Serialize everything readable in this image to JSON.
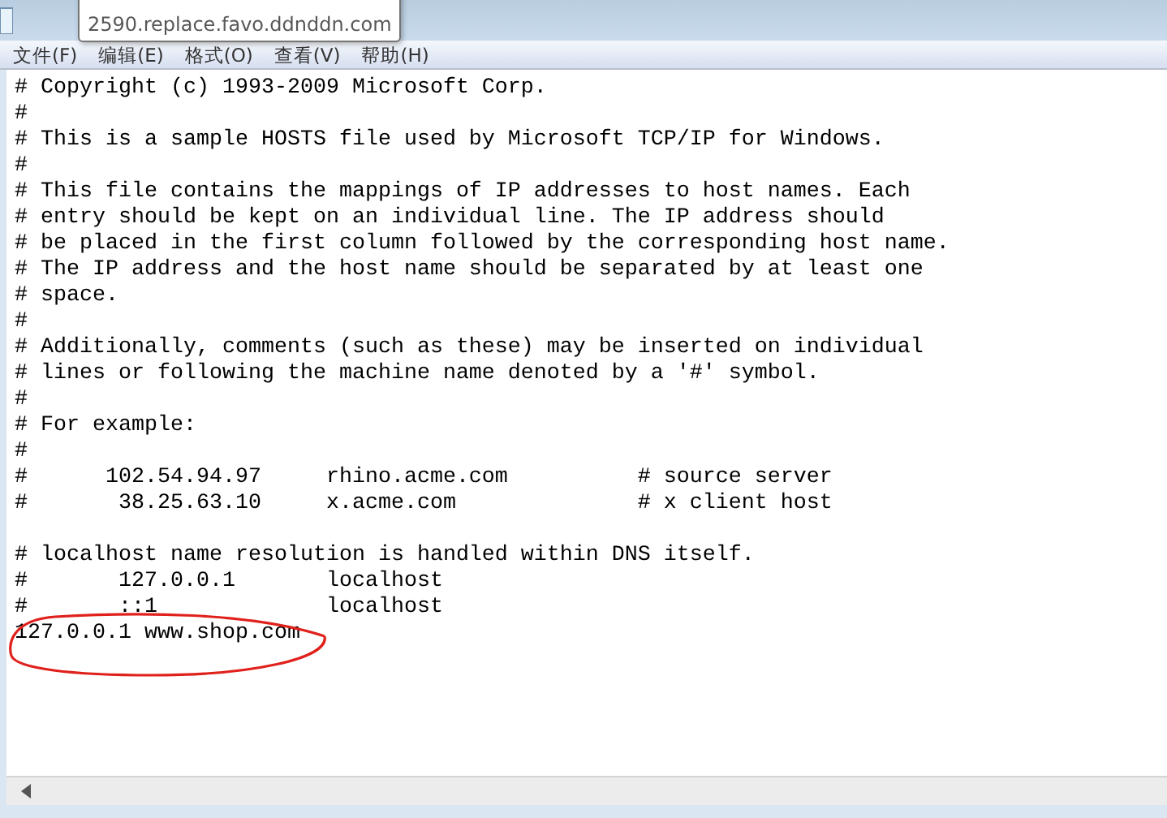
{
  "tooltip": {
    "text": "2590.replace.favo.ddnddn.com"
  },
  "menu": [
    "文件(F)",
    "编辑(E)",
    "格式(O)",
    "查看(V)",
    "帮助(H)"
  ],
  "sections": [
    [
      "# Copyright (c) 1993-2009 Microsoft Corp.",
      "#",
      "# This is a sample HOSTS file used by Microsoft TCP/IP for Windows.",
      "#",
      "# This file contains the mappings of IP addresses to host names. Each",
      "# entry should be kept on an individual line. The IP address should",
      "# be placed in the first column followed by the corresponding host name.",
      "# The IP address and the host name should be separated by at least one",
      "# space.",
      "#",
      "# Additionally, comments (such as these) may be inserted on individual",
      "# lines or following the machine name denoted by a '#' symbol.",
      "#",
      "# For example:",
      "#",
      "#      102.54.94.97     rhino.acme.com          # source server",
      "#       38.25.63.10     x.acme.com              # x client host"
    ],
    [
      "# localhost name resolution is handled within DNS itself.",
      "#       127.0.0.1       localhost",
      "#       ::1             localhost",
      "127.0.0.1 www.shop.com"
    ]
  ]
}
